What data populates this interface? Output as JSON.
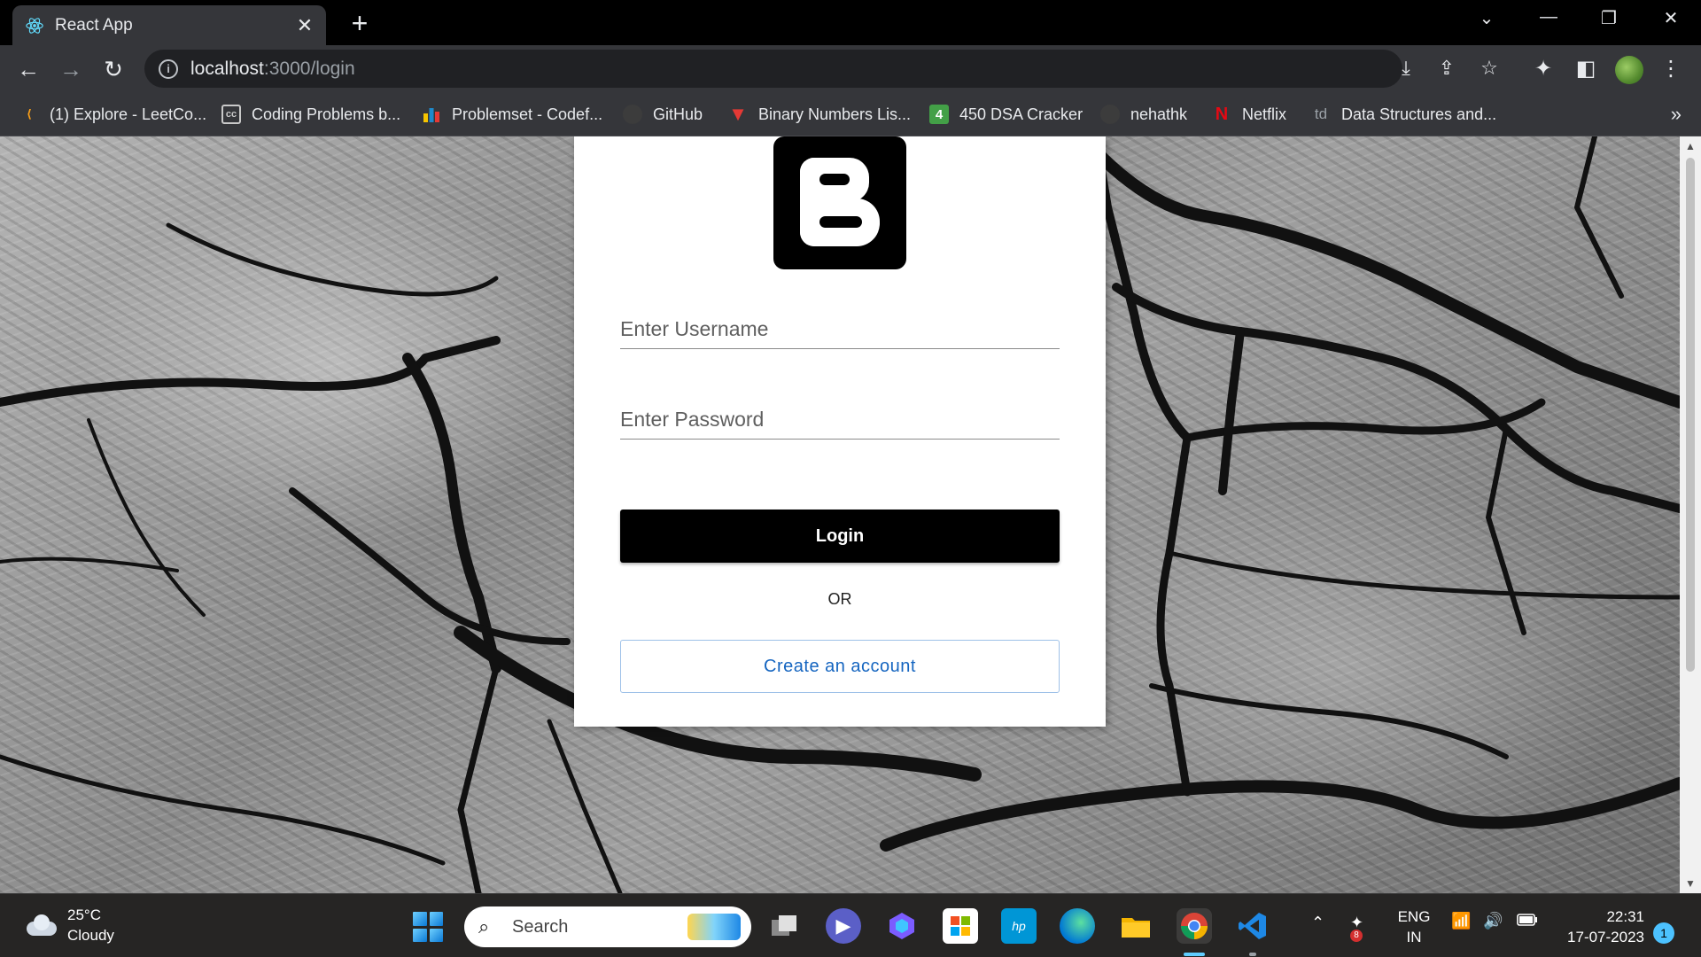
{
  "browser": {
    "tab_title": "React App",
    "tab_close": "✕",
    "new_tab": "+",
    "url_host": "localhost",
    "url_path": ":3000/login",
    "window_controls": {
      "chevron": "⌄",
      "minimize": "—",
      "restore": "❐",
      "close": "✕"
    },
    "bookmarks": [
      {
        "label": "(1) Explore - LeetCo...",
        "icon": "leetcode-icon",
        "color": "#ffa116"
      },
      {
        "label": "Coding Problems b...",
        "icon": "codechef-icon",
        "color": "#c9c9c9"
      },
      {
        "label": "Problemset - Codef...",
        "icon": "codeforces-icon",
        "color": "#1f8acb"
      },
      {
        "label": "GitHub",
        "icon": "github-icon",
        "color": "#3c3c3c"
      },
      {
        "label": "Binary Numbers Lis...",
        "icon": "bookmark-red-icon",
        "color": "#e53935"
      },
      {
        "label": "450 DSA Cracker",
        "icon": "dsa-cracker-icon",
        "color": "#43a047",
        "badge": "4"
      },
      {
        "label": "nehathk",
        "icon": "github-icon",
        "color": "#3c3c3c"
      },
      {
        "label": "Netflix",
        "icon": "netflix-icon",
        "color": "#e50914",
        "badge": "N"
      },
      {
        "label": "Data Structures and...",
        "icon": "takeuforward-icon",
        "color": "#9aa0a6",
        "badge": "td"
      }
    ],
    "bookmarks_more": "»"
  },
  "login": {
    "username_placeholder": "Enter Username",
    "password_placeholder": "Enter Password",
    "login_label": "Login",
    "or_label": "OR",
    "create_label": "Create an account",
    "accent": "#1565c0"
  },
  "taskbar": {
    "weather_temp": "25°C",
    "weather_desc": "Cloudy",
    "search_label": "Search",
    "lang_line1": "ENG",
    "lang_line2": "IN",
    "time": "22:31",
    "date": "17-07-2023",
    "notification_count": "1",
    "tray_badge": "8"
  }
}
